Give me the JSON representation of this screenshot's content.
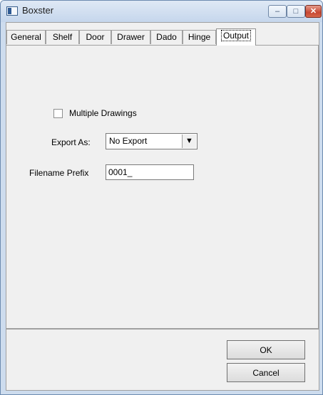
{
  "window": {
    "title": "Boxster"
  },
  "title_buttons": {
    "minimize": "–",
    "maximize": "□",
    "close": "✕"
  },
  "tabs": [
    {
      "label": "General"
    },
    {
      "label": "Shelf"
    },
    {
      "label": "Door"
    },
    {
      "label": "Drawer"
    },
    {
      "label": "Dado"
    },
    {
      "label": "Hinge"
    },
    {
      "label": "Output",
      "active": true
    }
  ],
  "output": {
    "multiple_drawings": {
      "label": "Multiple Drawings",
      "checked": false
    },
    "export_as": {
      "label": "Export As:",
      "value": "No Export"
    },
    "filename_prefix": {
      "label": "Filename Prefix",
      "value": "0001_"
    }
  },
  "buttons": {
    "ok": "OK",
    "cancel": "Cancel"
  },
  "icons": {
    "dropdown": "▼"
  }
}
